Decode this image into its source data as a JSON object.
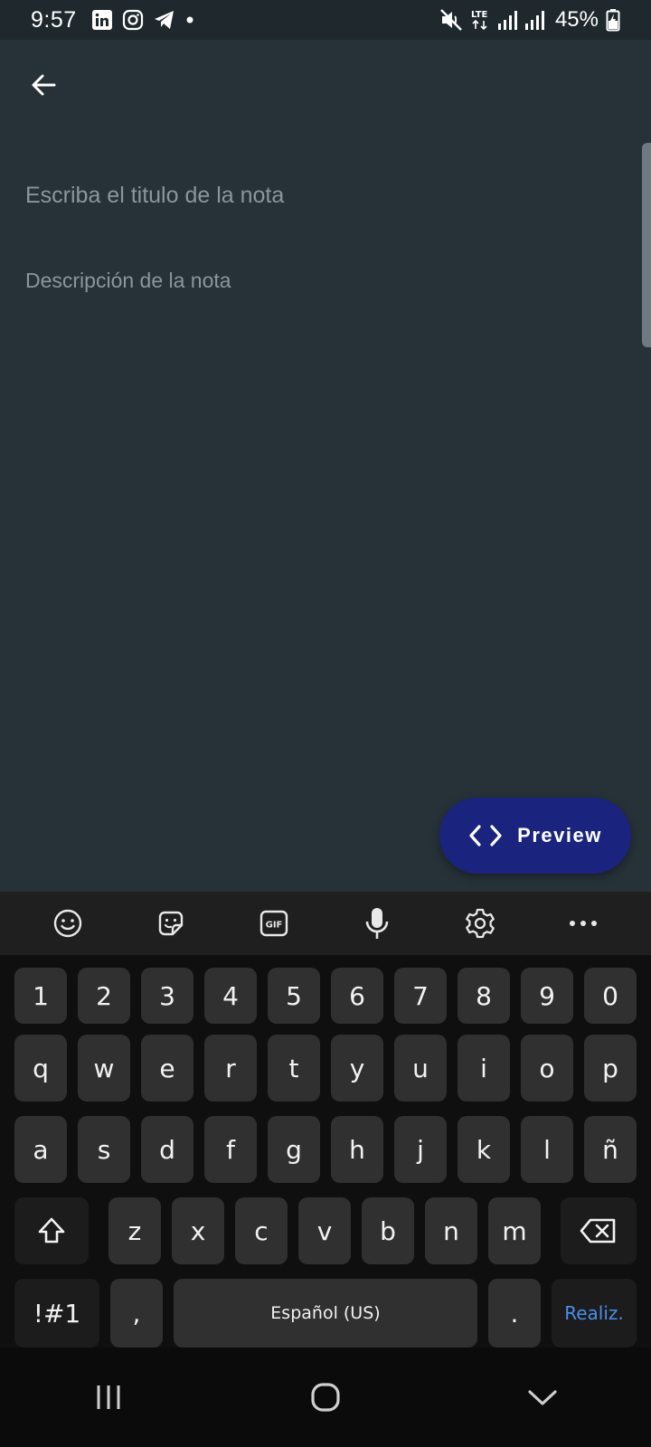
{
  "status_bar": {
    "time": "9:57",
    "network": "LTE",
    "battery": "45%",
    "icons": [
      "linkedin-icon",
      "instagram-icon",
      "telegram-icon",
      "dot-icon",
      "mute-icon",
      "signal-icon",
      "battery-charging-icon"
    ]
  },
  "app": {
    "title_placeholder": "Escriba el titulo de la nota",
    "description_placeholder": "Descripción de la nota",
    "title_value": "",
    "description_value": "",
    "preview_label": "Preview",
    "accent_color": "#1a237e",
    "background_color": "#263238"
  },
  "keyboard": {
    "toolbar": [
      "emoji-icon",
      "sticker-icon",
      "gif-icon",
      "microphone-icon",
      "settings-icon",
      "more-icon"
    ],
    "row_numbers": [
      "1",
      "2",
      "3",
      "4",
      "5",
      "6",
      "7",
      "8",
      "9",
      "0"
    ],
    "row_top": [
      "q",
      "w",
      "e",
      "r",
      "t",
      "y",
      "u",
      "i",
      "o",
      "p"
    ],
    "row_mid": [
      "a",
      "s",
      "d",
      "f",
      "g",
      "h",
      "j",
      "k",
      "l",
      "ñ"
    ],
    "row_bottom": [
      "z",
      "x",
      "c",
      "v",
      "b",
      "n",
      "m"
    ],
    "symbols_label": "!#1",
    "comma_label": ",",
    "space_label": "Español (US)",
    "period_label": ".",
    "done_label": "Realiz."
  }
}
